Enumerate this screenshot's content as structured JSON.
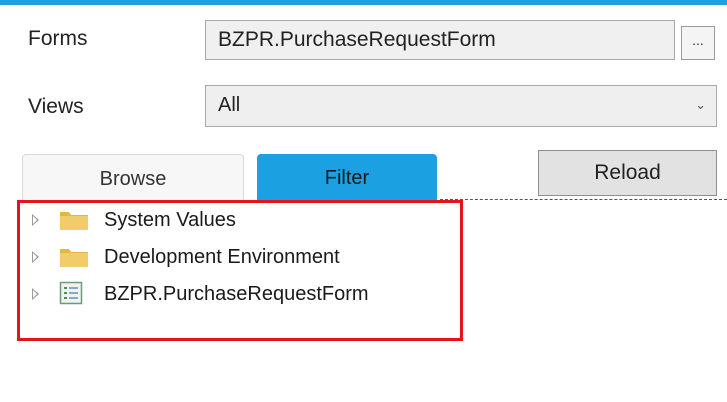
{
  "colors": {
    "accent": "#1ba1e2",
    "highlight": "#e5141c"
  },
  "forms": {
    "label": "Forms",
    "value": "BZPR.PurchaseRequestForm",
    "browse_button": "..."
  },
  "views": {
    "label": "Views",
    "selected": "All"
  },
  "tabs": [
    {
      "label": "Browse",
      "active": false
    },
    {
      "label": "Filter",
      "active": true
    }
  ],
  "reload": {
    "label": "Reload"
  },
  "tree": {
    "nodes": [
      {
        "label": "System Values",
        "icon": "folder-icon"
      },
      {
        "label": "Development Environment",
        "icon": "folder-icon"
      },
      {
        "label": "BZPR.PurchaseRequestForm",
        "icon": "form-icon"
      }
    ]
  }
}
